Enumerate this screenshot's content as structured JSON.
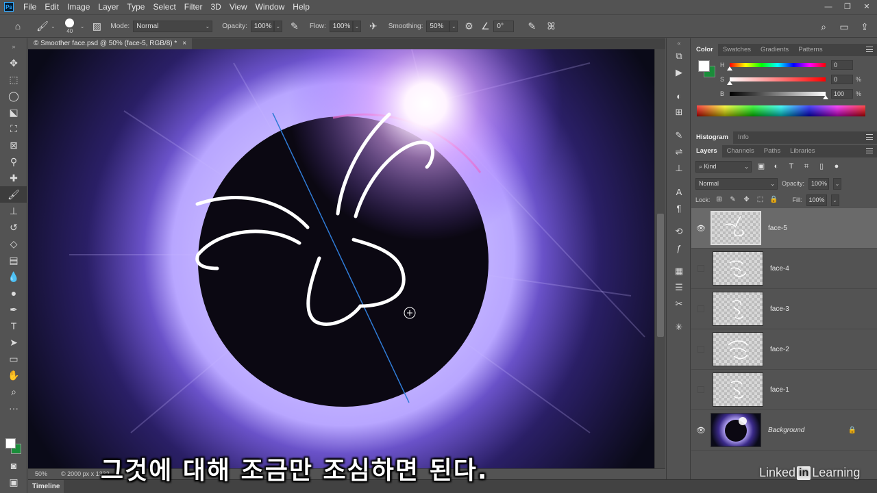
{
  "app": {
    "logo": "Ps",
    "menu": [
      "File",
      "Edit",
      "Image",
      "Layer",
      "Type",
      "Select",
      "Filter",
      "3D",
      "View",
      "Window",
      "Help"
    ]
  },
  "options": {
    "brush_size": "40",
    "mode_label": "Mode:",
    "mode_value": "Normal",
    "opacity_label": "Opacity:",
    "opacity_value": "100%",
    "flow_label": "Flow:",
    "flow_value": "100%",
    "smoothing_label": "Smoothing:",
    "smoothing_value": "50%",
    "angle_value": "0°"
  },
  "document": {
    "tab_title": "© Smoother face.psd @ 50% (face-5, RGB/8) *",
    "zoom": "50%",
    "doc_info": "© 2000 px x 1332"
  },
  "color_panel": {
    "tabs": [
      "Color",
      "Swatches",
      "Gradients",
      "Patterns"
    ],
    "h_label": "H",
    "h_value": "0",
    "h_unit": "",
    "s_label": "S",
    "s_value": "0",
    "s_unit": "%",
    "b_label": "B",
    "b_value": "100",
    "b_unit": "%",
    "fg_color": "#ffffff",
    "bg_color": "#1a8d3a"
  },
  "histogram_panel": {
    "tabs": [
      "Histogram",
      "Info"
    ]
  },
  "layers_panel": {
    "tabs": [
      "Layers",
      "Channels",
      "Paths",
      "Libraries"
    ],
    "kind_label": "Kind",
    "blend_mode": "Normal",
    "opacity_label": "Opacity:",
    "opacity_value": "100%",
    "lock_label": "Lock:",
    "fill_label": "Fill:",
    "fill_value": "100%",
    "layers": [
      {
        "name": "face-5",
        "visible": true,
        "selected": true
      },
      {
        "name": "face-4",
        "visible": false,
        "selected": false
      },
      {
        "name": "face-3",
        "visible": false,
        "selected": false
      },
      {
        "name": "face-2",
        "visible": false,
        "selected": false
      },
      {
        "name": "face-1",
        "visible": false,
        "selected": false
      },
      {
        "name": "Background",
        "visible": true,
        "selected": false,
        "locked": true
      }
    ]
  },
  "timeline": {
    "label": "Timeline"
  },
  "overlay": {
    "subtitle": "그것에 대해 조금만 조심하면 된다.",
    "watermark_pre": "Linked",
    "watermark_in": "in",
    "watermark_post": "Learning"
  }
}
